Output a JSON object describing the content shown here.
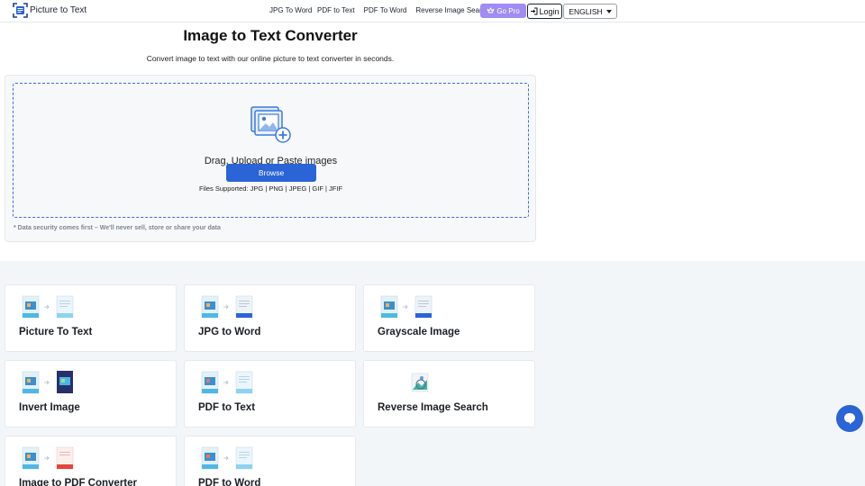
{
  "header": {
    "logo_text": "Picture to Text",
    "nav": [
      "JPG To Word",
      "PDF to Text",
      "PDF To Word",
      "Reverse Image Search"
    ],
    "go_pro_label": "Go Pro",
    "login_label": "Login",
    "language_selected": "ENGLISH"
  },
  "hero": {
    "title": "Image to Text Converter",
    "subtitle": "Convert image to text with our online picture to text converter in seconds."
  },
  "upload": {
    "drag_text": "Drag, Upload or Paste images",
    "browse_label": "Browse",
    "files_supported": "Files Supported: JPG | PNG | JPEG | GIF | JFIF",
    "security_note": "* Data security comes first – We'll never sell, store or share your data"
  },
  "tools": [
    {
      "label": "Picture To Text",
      "target_icon": "txt-file-icon"
    },
    {
      "label": "JPG to Word",
      "target_icon": "doc-file-icon"
    },
    {
      "label": "Grayscale Image",
      "target_icon": "doc-file-icon"
    },
    {
      "label": "Invert Image",
      "target_icon": "inverted-image-icon"
    },
    {
      "label": "PDF to Text",
      "target_icon": "txt-file-icon"
    },
    {
      "label": "Reverse Image Search",
      "target_icon": "image-search-icon"
    },
    {
      "label": "Image to PDF Converter",
      "target_icon": "pdf-file-icon"
    },
    {
      "label": "PDF to Word",
      "target_icon": "txt-file-icon"
    }
  ],
  "colors": {
    "primary": "#2a64d6",
    "go_pro": "#9f8cf4",
    "tools_bg": "#f3f6f9"
  }
}
